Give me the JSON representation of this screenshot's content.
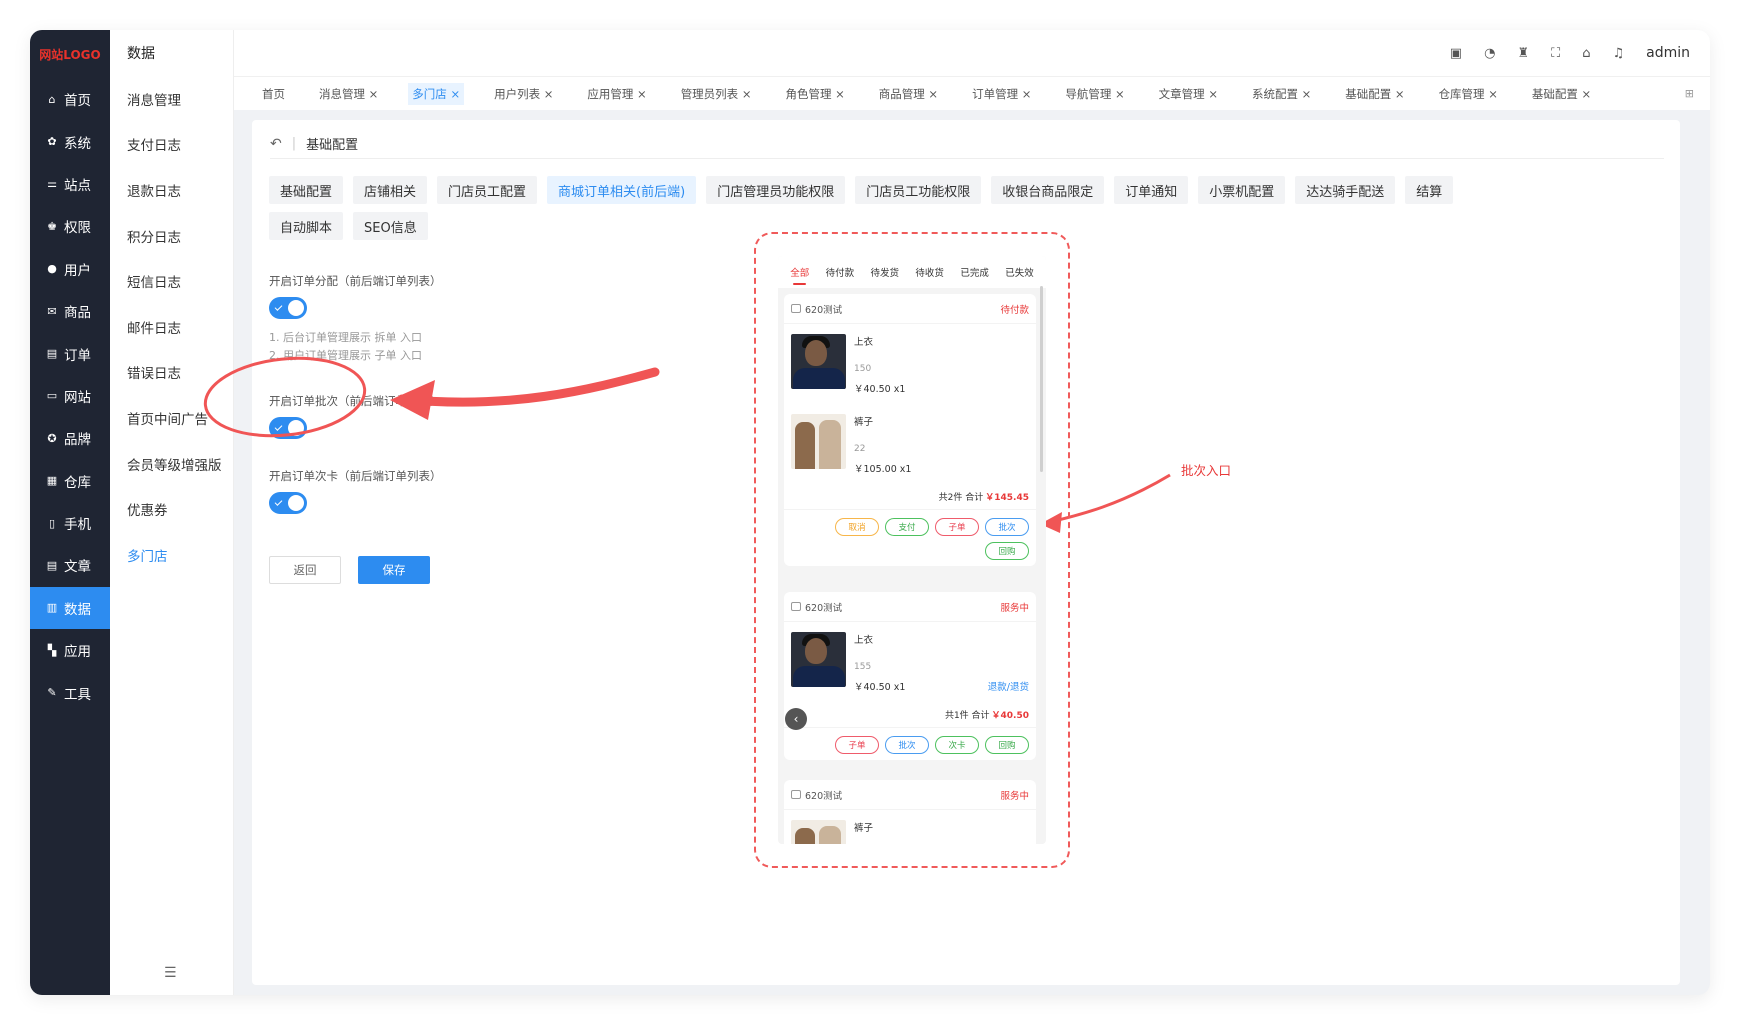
{
  "brand": {
    "logo_text": "网站LOGO",
    "accent": "#2d8cf0",
    "alert": "#e83838"
  },
  "nav": {
    "items": [
      {
        "icon": "home-icon",
        "label": "首页"
      },
      {
        "icon": "gear-icon",
        "label": "系统"
      },
      {
        "icon": "sitemap-icon",
        "label": "站点"
      },
      {
        "icon": "user-key-icon",
        "label": "权限"
      },
      {
        "icon": "user-icon",
        "label": "用户"
      },
      {
        "icon": "mail-icon",
        "label": "商品"
      },
      {
        "icon": "clipboard-icon",
        "label": "订单"
      },
      {
        "icon": "monitor-icon",
        "label": "网站"
      },
      {
        "icon": "badge-icon",
        "label": "品牌"
      },
      {
        "icon": "warehouse-icon",
        "label": "仓库"
      },
      {
        "icon": "mobile-icon",
        "label": "手机"
      },
      {
        "icon": "article-icon",
        "label": "文章"
      },
      {
        "icon": "chart-icon",
        "label": "数据"
      },
      {
        "icon": "apps-icon",
        "label": "应用"
      },
      {
        "icon": "wrench-icon",
        "label": "工具"
      }
    ],
    "active_index": 12
  },
  "subnav": {
    "title": "数据",
    "items": [
      "消息管理",
      "支付日志",
      "退款日志",
      "积分日志",
      "短信日志",
      "邮件日志",
      "错误日志",
      "首页中间广告",
      "会员等级增强版",
      "优惠券",
      "多门店"
    ],
    "active_index": 10
  },
  "topbar": {
    "user": "admin",
    "icons": [
      "translate-icon",
      "palette-icon",
      "cleanup-icon",
      "fullscreen-icon",
      "home-icon",
      "bell-icon"
    ]
  },
  "tabs": {
    "items": [
      "首页",
      "消息管理 ×",
      "多门店 ×",
      "用户列表 ×",
      "应用管理 ×",
      "管理员列表 ×",
      "角色管理 ×",
      "商品管理 ×",
      "订单管理 ×",
      "导航管理 ×",
      "文章管理 ×",
      "系统配置 ×",
      "基础配置 ×",
      "仓库管理 ×",
      "基础配置 ×"
    ],
    "active_index": 2
  },
  "page": {
    "breadcrumb": "基础配置",
    "config_tabs": [
      "基础配置",
      "店铺相关",
      "门店员工配置",
      "商城订单相关(前后端)",
      "门店管理员功能权限",
      "门店员工功能权限",
      "收银台商品限定",
      "订单通知",
      "小票机配置",
      "达达骑手配送",
      "结算",
      "自动脚本",
      "SEO信息"
    ],
    "config_active_index": 3,
    "fields": [
      {
        "label": "开启订单分配（前后端订单列表）",
        "enabled": true,
        "hints": [
          "1. 后台订单管理展示 拆单 入口",
          "2. 用户订单管理展示 子单 入口"
        ]
      },
      {
        "label": "开启订单批次（前后端订单列表）",
        "enabled": true,
        "hints": []
      },
      {
        "label": "开启订单次卡（前后端订单列表）",
        "enabled": true,
        "hints": []
      }
    ],
    "back_btn": "返回",
    "save_btn": "保存"
  },
  "annotation": {
    "label": "批次入口",
    "color": "#e83838"
  },
  "phone": {
    "tabs": [
      "全部",
      "待付款",
      "待发货",
      "待收货",
      "已完成",
      "已失效"
    ],
    "active_tab": 0,
    "orders": [
      {
        "shop": "620测试",
        "status": "待付款",
        "items": [
          {
            "name": "上衣",
            "spec": "150",
            "price": "￥40.50 x1",
            "refund": ""
          },
          {
            "name": "裤子",
            "spec": "22",
            "price": "￥105.00 x1",
            "refund": ""
          }
        ],
        "summary": "共2件 合计",
        "amount": "￥145.45",
        "buttons": [
          {
            "label": "取消",
            "color": "orange"
          },
          {
            "label": "支付",
            "color": "green"
          },
          {
            "label": "子单",
            "color": "red"
          },
          {
            "label": "批次",
            "color": "blue"
          },
          {
            "label": "回购",
            "color": "green"
          }
        ]
      },
      {
        "shop": "620测试",
        "status": "服务中",
        "items": [
          {
            "name": "上衣",
            "spec": "155",
            "price": "￥40.50 x1",
            "refund": "退款/退货"
          }
        ],
        "summary": "共1件 合计",
        "amount": "￥40.50",
        "buttons": [
          {
            "label": "子单",
            "color": "red"
          },
          {
            "label": "批次",
            "color": "blue"
          },
          {
            "label": "次卡",
            "color": "green"
          },
          {
            "label": "回购",
            "color": "green"
          }
        ]
      },
      {
        "shop": "620测试",
        "status": "服务中",
        "items": [
          {
            "name": "裤子",
            "spec": "",
            "price": "",
            "refund": ""
          }
        ]
      }
    ]
  }
}
